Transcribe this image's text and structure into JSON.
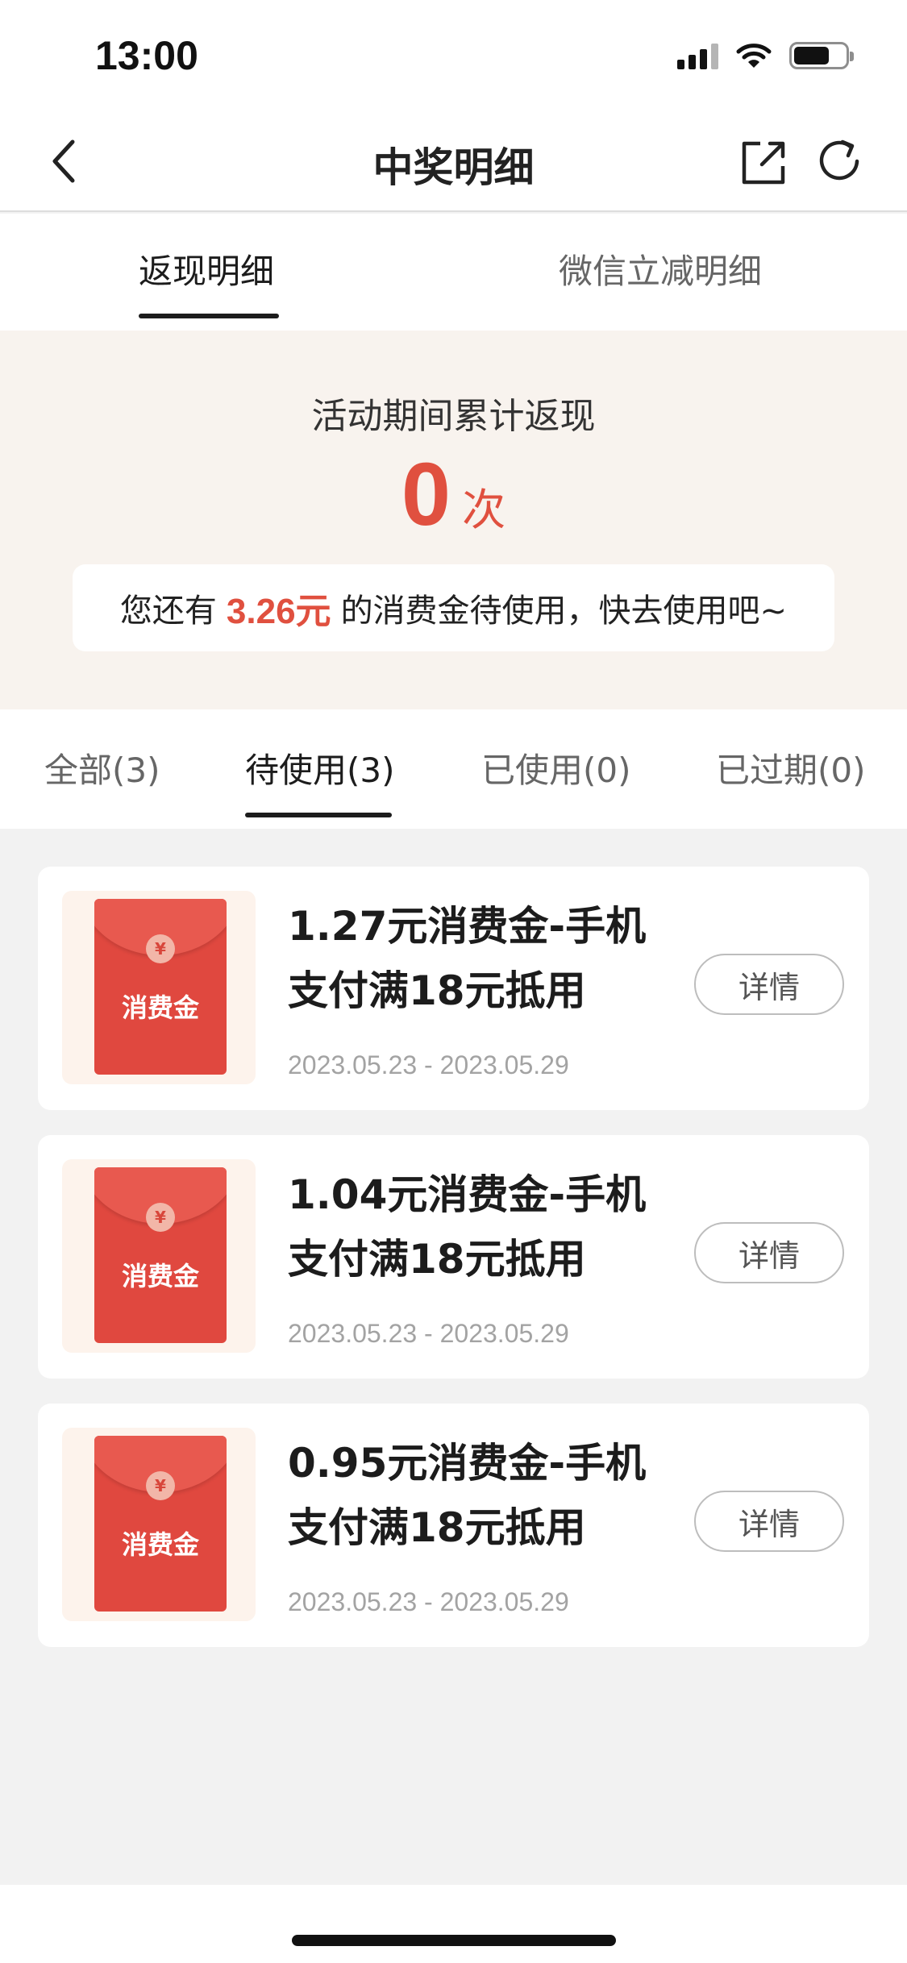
{
  "status_bar": {
    "time": "13:00",
    "battery_level": 0.7
  },
  "nav": {
    "title": "中奖明细",
    "icons": {
      "back": "back-arrow-icon",
      "share": "share-icon",
      "refresh": "refresh-icon"
    }
  },
  "top_tabs": [
    {
      "label": "返现明细",
      "active": true
    },
    {
      "label": "微信立减明细",
      "active": false
    }
  ],
  "summary": {
    "label": "活动期间累计返现",
    "count": "0",
    "unit": "次",
    "notice_prefix": "您还有",
    "notice_amount": "3.26元",
    "notice_suffix": "的消费金待使用，快去使用吧~"
  },
  "filter_tabs": [
    {
      "label": "全部(3)",
      "active": false
    },
    {
      "label": "待使用(3)",
      "active": true
    },
    {
      "label": "已使用(0)",
      "active": false
    },
    {
      "label": "已过期(0)",
      "active": false
    }
  ],
  "cards": [
    {
      "title_line1": "1.27元消费金-手机",
      "title_line2": "支付满18元抵用",
      "date": "2023.05.23 - 2023.05.29",
      "envelope_label": "消费金",
      "coin": "¥",
      "button": "详情"
    },
    {
      "title_line1": "1.04元消费金-手机",
      "title_line2": "支付满18元抵用",
      "date": "2023.05.23 - 2023.05.29",
      "envelope_label": "消费金",
      "coin": "¥",
      "button": "详情"
    },
    {
      "title_line1": "0.95元消费金-手机",
      "title_line2": "支付满18元抵用",
      "date": "2023.05.23 - 2023.05.29",
      "envelope_label": "消费金",
      "coin": "¥",
      "button": "详情"
    }
  ],
  "colors": {
    "accent": "#e0503f",
    "summary_bg": "#f8f3ee",
    "page_bg": "#f2f2f2"
  }
}
